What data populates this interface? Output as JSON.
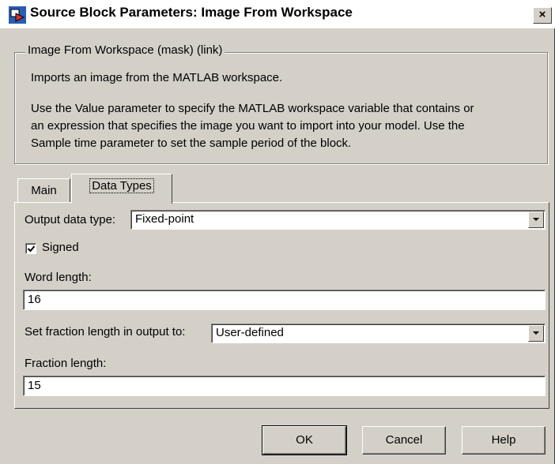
{
  "window": {
    "title": "Source Block Parameters: Image From Workspace",
    "close_label": "×"
  },
  "group": {
    "legend": "Image From Workspace (mask) (link)",
    "lines": [
      "Imports an image from the MATLAB workspace.",
      "Use the Value parameter to specify the MATLAB workspace variable that contains or",
      "an expression that specifies the image you want to import into your model. Use the",
      "Sample time parameter to set the sample period of the block."
    ]
  },
  "tabs": [
    {
      "label": "Main",
      "selected": false
    },
    {
      "label": "Data Types",
      "selected": true
    }
  ],
  "form": {
    "output_type_label": "Output data type:",
    "output_type_value": "Fixed-point",
    "signed_label": "Signed",
    "signed_checked": true,
    "word_length_label": "Word length:",
    "word_length_value": "16",
    "fraction_mode_label": "Set fraction length in output to:",
    "fraction_mode_value": "User-defined",
    "fraction_length_label": "Fraction length:",
    "fraction_length_value": "15"
  },
  "buttons": {
    "ok": "OK",
    "cancel": "Cancel",
    "help": "Help"
  }
}
